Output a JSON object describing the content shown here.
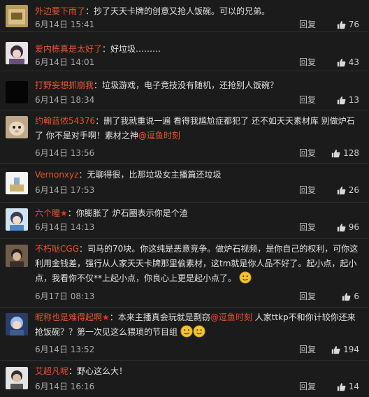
{
  "actions": {
    "reply_label": "回复"
  },
  "comments": [
    {
      "username": "外边要下雨了",
      "sep": "：",
      "text": "抄了天天卡牌的创意又抢人饭碗。可以的兄弟。",
      "time": "6月14日 15:41",
      "likes": "76"
    },
    {
      "username": "爱内栋真是太好了",
      "sep": "：",
      "text": "好垃圾………",
      "time": "6月14日 14:01",
      "likes": "43"
    },
    {
      "username": "打野妄想抓崩我",
      "sep": "：",
      "text": "垃圾游戏，电子竞技没有随机，还抢别人饭碗？",
      "time": "6月14日 18:34",
      "likes": "13"
    },
    {
      "username": "约翰蓝侬54376",
      "sep": "：",
      "text": "删了我就重说一遍 看得我尴尬症都犯了 还不如天天素材库 别做炉石了 你不是对手啊！素材之神",
      "mention": "@逗鱼时刻",
      "time": "6月14日 13:56",
      "likes": "128"
    },
    {
      "username": "Vernonxyz",
      "sep": "：",
      "text": "无聊得很，比那垃圾女主播篇还垃圾",
      "time": "6月14日 17:53",
      "likes": "26"
    },
    {
      "username": "六个瞳",
      "star": "★",
      "sep": "：",
      "text": "你膨胀了 炉石圈表示你是个渣",
      "time": "6月14日 14:13",
      "likes": "96"
    },
    {
      "username": "不朽哒CGG",
      "sep": "：",
      "text": "司马的70块。你这纯是恶意竞争。做炉石视频，是你自己的权利，可你这利用金钱差，强行从人家天天卡牌那里偷素材，这tm就是你人品不好了。起小点，起小点，我看你不仅**上起小点，你良心上更是起小点了。",
      "time": "6月17日 08:13",
      "likes": "6"
    },
    {
      "username": "昵称也是难得起啊",
      "star": "★",
      "sep": "：",
      "text_a": "本来主播真会玩就是剽窃",
      "mention": "@逗鱼时刻",
      "text_b": " 人家ttkp不和你计较你还来抢饭碗？？第一次见这么猥琐的节目组",
      "time": "6月14日 13:52",
      "likes": "194"
    },
    {
      "username": "艾超凡呢",
      "sep": "：",
      "text": "野心这么大！",
      "time": "6月14日 16:16",
      "likes": "14"
    }
  ]
}
